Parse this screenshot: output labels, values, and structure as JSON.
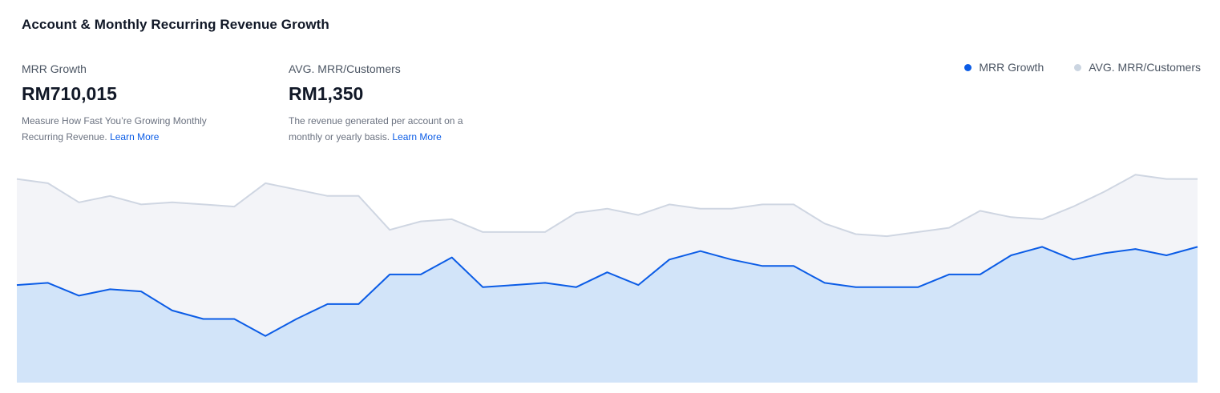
{
  "card": {
    "title": "Account & Monthly Recurring Revenue Growth"
  },
  "kpis": [
    {
      "label": "MRR Growth",
      "value": "RM710,015",
      "description": "Measure How Fast You’re Growing Monthly Recurring Revenue.",
      "link": "Learn More"
    },
    {
      "label": "AVG. MRR/Customers",
      "value": "RM1,350",
      "description": "The revenue generated per account on a monthly or yearly basis.",
      "link": "Learn More"
    }
  ],
  "legend": [
    {
      "label": "MRR Growth",
      "color": "#0b5ce6"
    },
    {
      "label": "AVG. MRR/Customers",
      "color": "#cbd5e1"
    }
  ],
  "chart_data": {
    "type": "area",
    "title": "",
    "xlabel": "",
    "ylabel": "",
    "grid": false,
    "legend_position": "top-right",
    "ylim": [
      0,
      100
    ],
    "x": [
      0,
      1,
      2,
      3,
      4,
      5,
      6,
      7,
      8,
      9,
      10,
      11,
      12,
      13,
      14,
      15,
      16,
      17,
      18,
      19,
      20,
      21,
      22,
      23,
      24,
      25,
      26,
      27,
      28,
      29,
      30,
      31,
      32,
      33,
      34,
      35,
      36,
      37,
      38,
      39,
      40,
      41,
      42,
      43,
      44
    ],
    "series": [
      {
        "name": "MRR Growth",
        "color": "#0b5ce6",
        "fill": "#d2e4f9",
        "values": [
          46,
          47,
          41,
          44,
          43,
          34,
          30,
          30,
          22,
          30,
          37,
          37,
          51,
          51,
          59,
          45,
          46,
          47,
          45,
          52,
          46,
          58,
          62,
          58,
          55,
          55,
          47,
          45,
          45,
          45,
          51,
          51,
          60,
          64,
          58,
          61,
          63,
          60,
          64
        ]
      },
      {
        "name": "AVG. MRR/Customers",
        "color": "#cfd6e2",
        "fill": "#f3f4f8",
        "values": [
          96,
          94,
          85,
          88,
          84,
          85,
          84,
          83,
          94,
          91,
          88,
          88,
          72,
          76,
          77,
          71,
          71,
          71,
          80,
          82,
          79,
          84,
          82,
          82,
          84,
          84,
          75,
          70,
          69,
          71,
          73,
          81,
          78,
          77,
          83,
          90,
          98,
          96,
          96
        ]
      }
    ]
  }
}
